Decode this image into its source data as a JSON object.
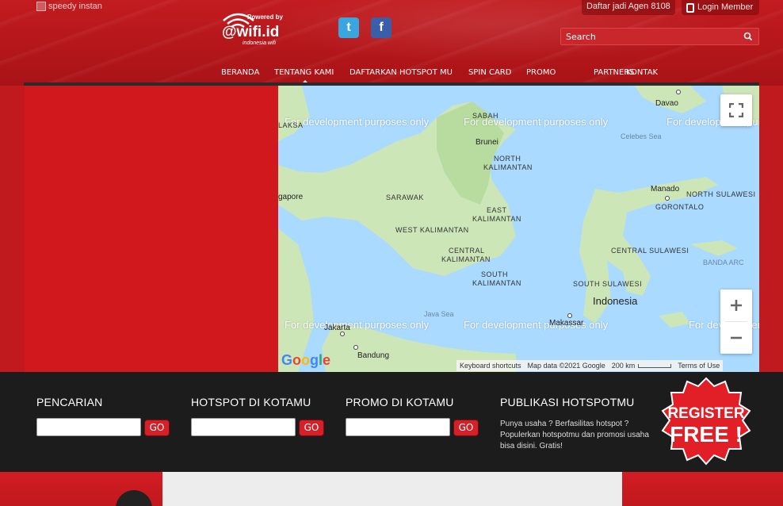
{
  "header": {
    "brand_alt": "speedy instan",
    "top_links": {
      "agent": "Daftar jadi Agen 8108",
      "login": "Login Member"
    },
    "search": {
      "placeholder": "Search"
    },
    "wifi_logo": {
      "powered_by": "Powered by",
      "brand": "@wifi.id",
      "tagline": "indonesia wifi"
    }
  },
  "nav": {
    "items": [
      {
        "label": "BERANDA"
      },
      {
        "label": "TENTANG KAMI"
      },
      {
        "label": "DAFTARKAN HOTSPOT MU"
      },
      {
        "label": "SPIN CARD"
      },
      {
        "label": "PROMO"
      },
      {
        "label": "PARTNERS"
      },
      {
        "label": "KONTAK"
      }
    ]
  },
  "map": {
    "watermark": "For development purposes only",
    "labels": {
      "sabah": "SABAH",
      "brunei": "Brunei",
      "north_kal": "NORTH",
      "kal": "KALIMANTAN",
      "celebes": "Celebes Sea",
      "davao": "Davao",
      "sarawak": "SARAWAK",
      "east_kal_1": "EAST",
      "east_kal_2": "KALIMANTAN",
      "manado": "Manado",
      "north_sulawesi": "NORTH SULAWESI",
      "gorontalo": "GORONTALO",
      "west_kal": "WEST KALIMANTAN",
      "central_kal_1": "CENTRAL",
      "central_kal_2": "KALIMANTAN",
      "central_sulawesi": "CENTRAL SULAWESI",
      "south_kal_1": "SOUTH",
      "south_kal_2": "KALIMANTAN",
      "south_sulawesi": "SOUTH SULAWESI",
      "indonesia": "Indonesia",
      "banda": "BANDA ARC",
      "java_sea": "Java Sea",
      "jakarta": "Jakarta",
      "bandung": "Bandung",
      "makassar": "Makassar",
      "singapore": "gapore",
      "malaysia": "LAKSA"
    },
    "attribution": {
      "shortcuts": "Keyboard shortcuts",
      "data": "Map data ©2021 Google",
      "scale": "200 km",
      "terms": "Terms of Use"
    }
  },
  "bottom": {
    "search_title": "PENCARIAN",
    "hotspot_title": "HOTSPOT DI KOTAMU",
    "promo_title": "PROMO DI KOTAMU",
    "publish_title": "PUBLIKASI HOTSPOTMU",
    "publish_text": "Punya usaha ? Berfasilitas hotspot ? Populerkan hotspotmu dan promosi usaha bisa disini. Gratis!",
    "go_label": "GO",
    "register_line1": "REGISTER",
    "register_line2": "FREE !"
  }
}
